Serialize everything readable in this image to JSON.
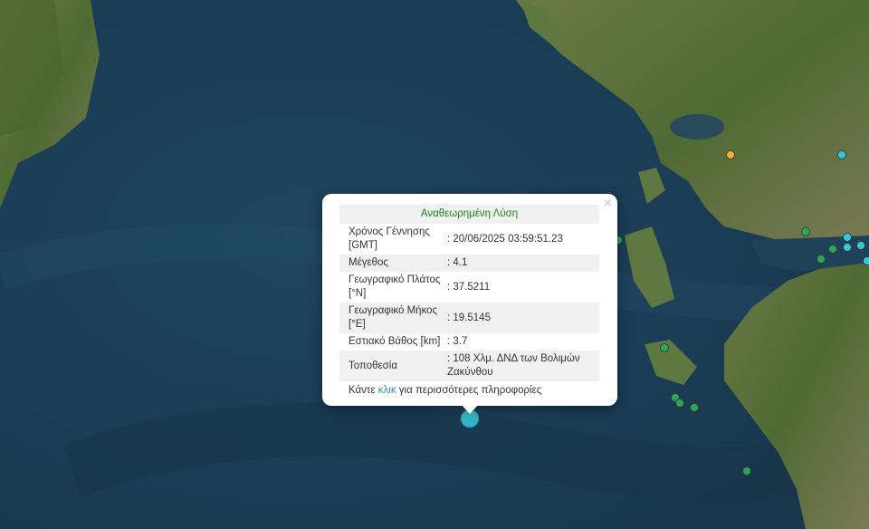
{
  "popup": {
    "heading": "Αναθεωρημένη Λύση",
    "close": "×",
    "rows": [
      {
        "label": "Χρόνος Γέννησης [GMT]",
        "value": ": 20/06/2025 03:59:51.23"
      },
      {
        "label": "Μέγεθος",
        "value": ": 4.1"
      },
      {
        "label": "Γεωγραφικό Πλάτος [°N]",
        "value": ": 37.5211"
      },
      {
        "label": "Γεωγραφικό Μήκος [°E]",
        "value": ": 19.5145"
      },
      {
        "label": "Εστιακό Βάθος [km]",
        "value": ": 3.7"
      },
      {
        "label": "Τοποθεσία",
        "value": ": 108 Χλμ. ΔΝΔ των Βολιμών Ζακύνθου"
      }
    ],
    "more_prefix": "Κάντε ",
    "more_link": "κλικ",
    "more_suffix": " για περισσότερες πληροφορίες"
  },
  "colors": {
    "sea": "#1d3f57",
    "land": "#5a6e3a",
    "selected_marker": "#33b5c9",
    "marker_green": "#2aa65a",
    "marker_cyan": "#38c5d8",
    "marker_yellow": "#e8b832"
  }
}
